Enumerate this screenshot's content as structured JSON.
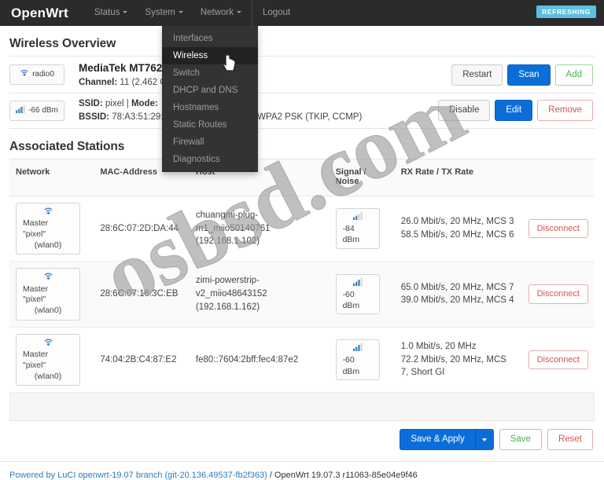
{
  "navbar": {
    "brand": "OpenWrt",
    "items": [
      {
        "label": "Status",
        "caret": true
      },
      {
        "label": "System",
        "caret": true
      },
      {
        "label": "Network",
        "caret": true
      },
      {
        "label": "Logout",
        "caret": false
      }
    ],
    "status_badge": "REFRESHING",
    "badge_color": "#5bc0de"
  },
  "dropdown": {
    "open_for": "Network",
    "items": [
      {
        "label": "Interfaces",
        "active": false
      },
      {
        "label": "Wireless",
        "active": true
      },
      {
        "label": "Switch",
        "active": false
      },
      {
        "label": "DHCP and DNS",
        "active": false
      },
      {
        "label": "Hostnames",
        "active": false
      },
      {
        "label": "Static Routes",
        "active": false
      },
      {
        "label": "Firewall",
        "active": false
      },
      {
        "label": "Diagnostics",
        "active": false
      }
    ]
  },
  "wireless_overview": {
    "title": "Wireless Overview",
    "radio_row": {
      "badge_label": "radio0",
      "badge_icon": "wifi-icon",
      "device_name": "MediaTek MT762",
      "channel_line_label": "Channel:",
      "channel_line_value": "11 (2.462 G",
      "buttons": [
        {
          "label": "Restart",
          "style": "default"
        },
        {
          "label": "Scan",
          "style": "primary"
        },
        {
          "label": "Add",
          "style": "success"
        }
      ]
    },
    "iface_row": {
      "badge_label": "-66 dBm",
      "badge_icon": "signal-bars-icon",
      "ssid_label": "SSID:",
      "ssid_value": "pixel",
      "mode_label": "Mode:",
      "bssid_label": "BSSID:",
      "bssid_value": "78:A3:51:29:",
      "encryption": "WPA/WPA2 PSK (TKIP, CCMP)",
      "buttons": [
        {
          "label": "Disable",
          "style": "default"
        },
        {
          "label": "Edit",
          "style": "primary"
        },
        {
          "label": "Remove",
          "style": "danger"
        }
      ]
    }
  },
  "stations": {
    "title": "Associated Stations",
    "columns": [
      "Network",
      "MAC-Address",
      "Host",
      "Signal / Noise",
      "RX Rate / TX Rate",
      ""
    ],
    "rows": [
      {
        "network_mode": "Master \"pixel\"",
        "network_iface": "(wlan0)",
        "network_icon": "wifi-icon",
        "mac": "28:6C:07:2D:DA:44",
        "host_name": "chuangmi-plug-m1_miio50140761",
        "host_ip": "(192.168.1.102)",
        "signal": "-84 dBm",
        "signal_icon": "signal-bars-icon",
        "rx_rate": "26.0 Mbit/s, 20 MHz, MCS 3",
        "tx_rate": "58.5 Mbit/s, 20 MHz, MCS 6",
        "action": "Disconnect"
      },
      {
        "network_mode": "Master \"pixel\"",
        "network_iface": "(wlan0)",
        "network_icon": "wifi-icon",
        "mac": "28:6C:07:16:3C:EB",
        "host_name": "zimi-powerstrip-v2_miio48643152",
        "host_ip": "(192.168.1.162)",
        "signal": "-60 dBm",
        "signal_icon": "signal-bars-icon",
        "rx_rate": "65.0 Mbit/s, 20 MHz, MCS 7",
        "tx_rate": "39.0 Mbit/s, 20 MHz, MCS 4",
        "action": "Disconnect"
      },
      {
        "network_mode": "Master \"pixel\"",
        "network_iface": "(wlan0)",
        "network_icon": "wifi-icon",
        "mac": "74:04:2B:C4:87:E2",
        "host_name": "fe80::7604:2bff:fec4:87e2",
        "host_ip": "",
        "signal": "-60 dBm",
        "signal_icon": "signal-bars-icon",
        "rx_rate": "1.0 Mbit/s, 20 MHz",
        "tx_rate": "72.2 Mbit/s, 20 MHz, MCS 7, Short GI",
        "action": "Disconnect"
      }
    ]
  },
  "action_bar": {
    "save_apply": "Save & Apply",
    "save": "Save",
    "reset": "Reset"
  },
  "footer": {
    "link_text": "Powered by LuCI openwrt-19.07 branch (git-20.136.49537-fb2f363)",
    "plain_text": " / OpenWrt 19.07.3 r11063-85e04e9f46"
  },
  "watermark": {
    "text": "osbsd.com",
    "color": "#8a8a8a"
  }
}
